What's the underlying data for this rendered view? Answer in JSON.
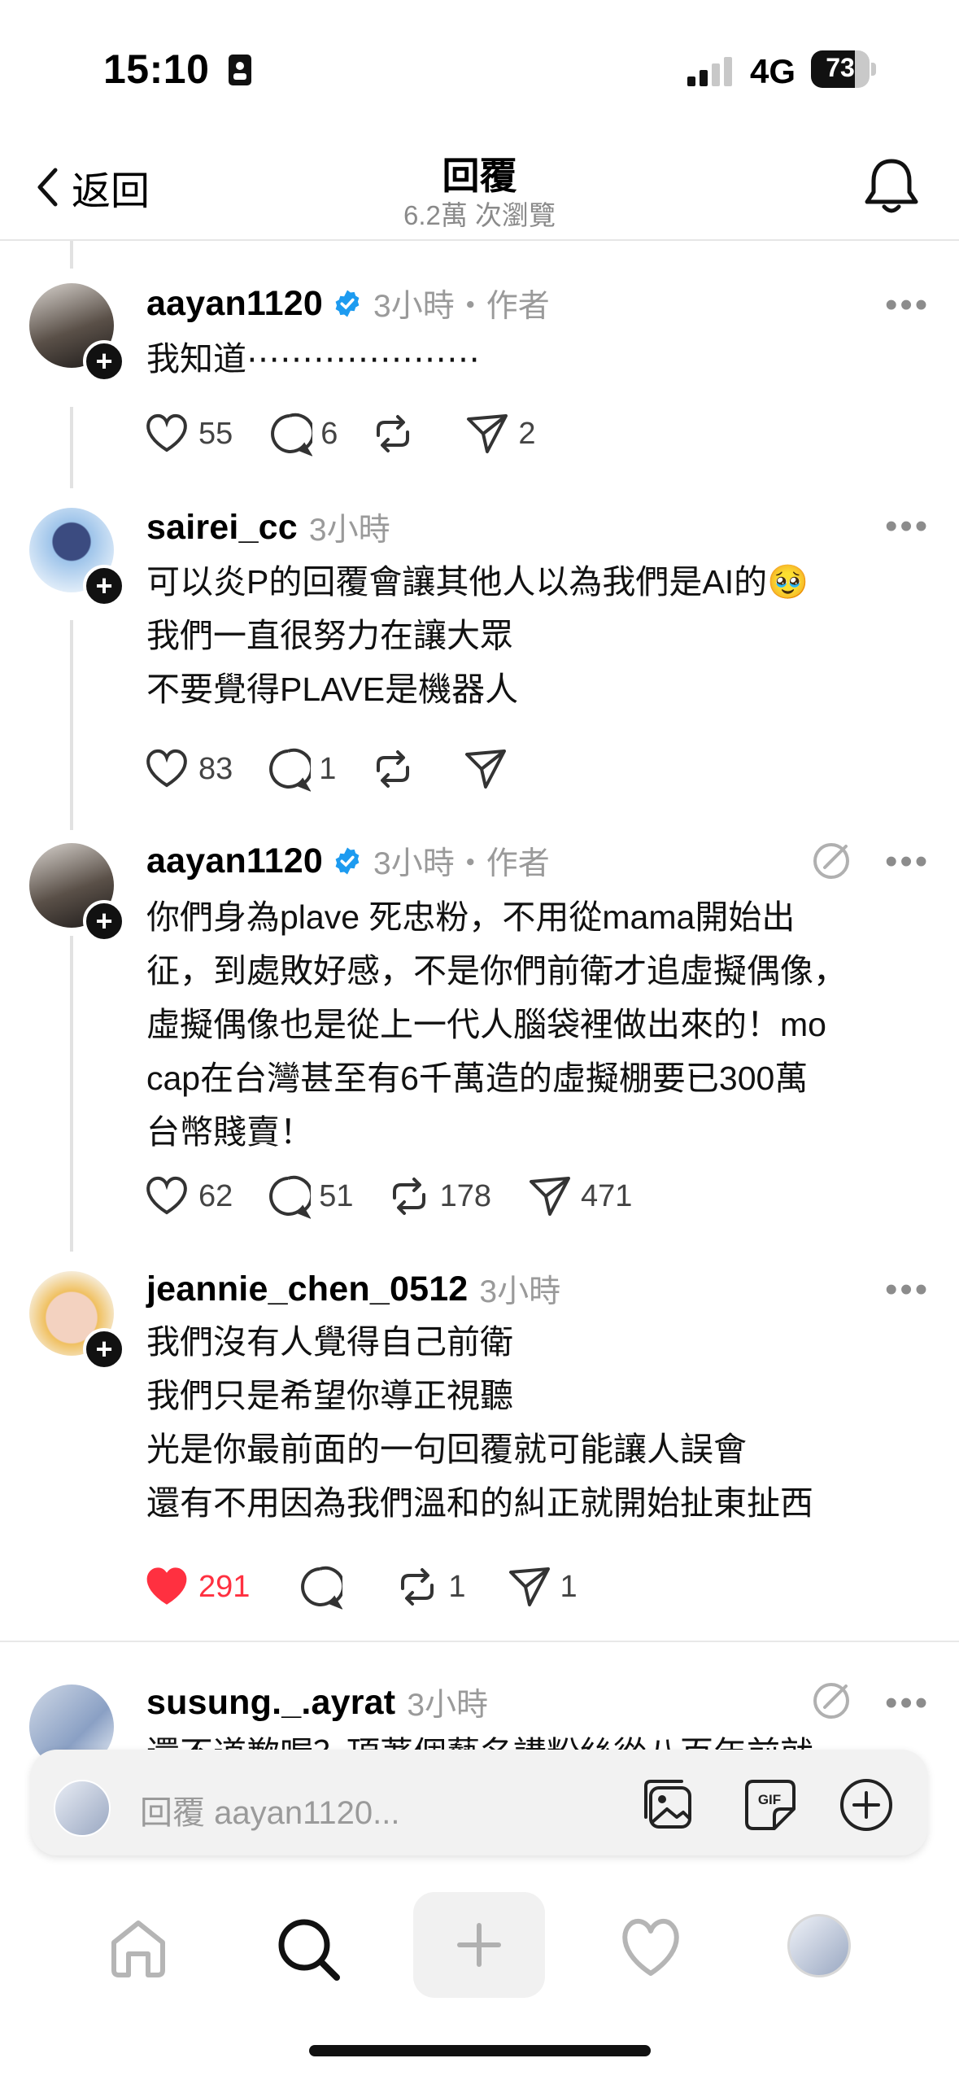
{
  "status_bar": {
    "time": "15:10",
    "network": "4G",
    "battery": "73"
  },
  "header": {
    "back_label": "返回",
    "title": "回覆",
    "views": "6.2萬 次瀏覽"
  },
  "posts": [
    {
      "username": "aayan1120",
      "verified": true,
      "time": "3小時",
      "author_tag": "・作者",
      "lines": [
        "我知道⋯⋯⋯⋯⋯⋯⋯"
      ],
      "likes": "55",
      "comments": "6",
      "reposts": "",
      "shares": "2",
      "liked": false
    },
    {
      "username": "sairei_cc",
      "verified": false,
      "time": "3小時",
      "author_tag": "",
      "lines": [
        "可以炎P的回覆會讓其他人以為我們是AI的🥹",
        "我們一直很努力在讓大眾",
        "不要覺得PLAVE是機器人"
      ],
      "likes": "83",
      "comments": "1",
      "reposts": "",
      "shares": "",
      "liked": false
    },
    {
      "username": "aayan1120",
      "verified": true,
      "time": "3小時",
      "author_tag": "・作者",
      "lines": [
        "你們身為plave 死忠粉，不用從mama開始出",
        "征，到處敗好感，不是你們前衛才追虛擬偶像，",
        "虛擬偶像也是從上一代人腦袋裡做出來的！mo",
        "cap在台灣甚至有6千萬造的虛擬棚要已300萬",
        "台幣賤賣！"
      ],
      "likes": "62",
      "comments": "51",
      "reposts": "178",
      "shares": "471",
      "liked": false
    },
    {
      "username": "jeannie_chen_0512",
      "verified": false,
      "time": "3小時",
      "author_tag": "",
      "lines": [
        "我們沒有人覺得自己前衛",
        "我們只是希望你導正視聽",
        "光是你最前面的一句回覆就可能讓人誤會",
        "還有不用因為我們溫和的糾正就開始扯東扯西"
      ],
      "likes": "291",
      "comments": "",
      "reposts": "1",
      "shares": "1",
      "liked": true
    },
    {
      "username": "susung._.ayrat",
      "verified": false,
      "time": "3小時",
      "author_tag": "",
      "lines": [
        "還不道歉喔？頂著個藝名講粉絲從八百年前就…"
      ],
      "likes": "",
      "comments": "",
      "reposts": "",
      "shares": "",
      "liked": false
    }
  ],
  "reply_box": {
    "placeholder": "回覆 aayan1120..."
  },
  "tab_bar": {
    "items": [
      "home-icon",
      "search-icon",
      "add-icon",
      "heart-icon",
      "profile-avatar"
    ]
  },
  "colors": {
    "verified": "#1d9bf0",
    "like_active": "#ff3040",
    "text_secondary": "#9a9a9a"
  }
}
